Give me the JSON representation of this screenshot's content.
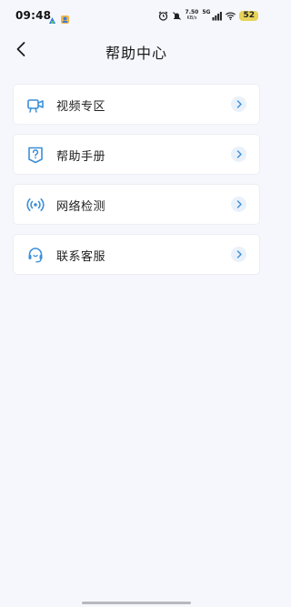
{
  "status_bar": {
    "time": "09:48",
    "net_speed": "7.50",
    "net_unit": "KB/s",
    "signal_label": "5G",
    "battery": "52"
  },
  "header": {
    "title": "帮助中心",
    "back_icon": "chevron-left-icon"
  },
  "menu": {
    "items": [
      {
        "label": "视频专区",
        "icon": "video-camera-icon"
      },
      {
        "label": "帮助手册",
        "icon": "help-manual-icon"
      },
      {
        "label": "网络检测",
        "icon": "network-signal-icon"
      },
      {
        "label": "联系客服",
        "icon": "headset-icon"
      }
    ]
  },
  "colors": {
    "accent": "#3b8fd8",
    "background": "#f6f7fc",
    "card": "#ffffff",
    "chevron_bg": "#e9f1fb"
  }
}
